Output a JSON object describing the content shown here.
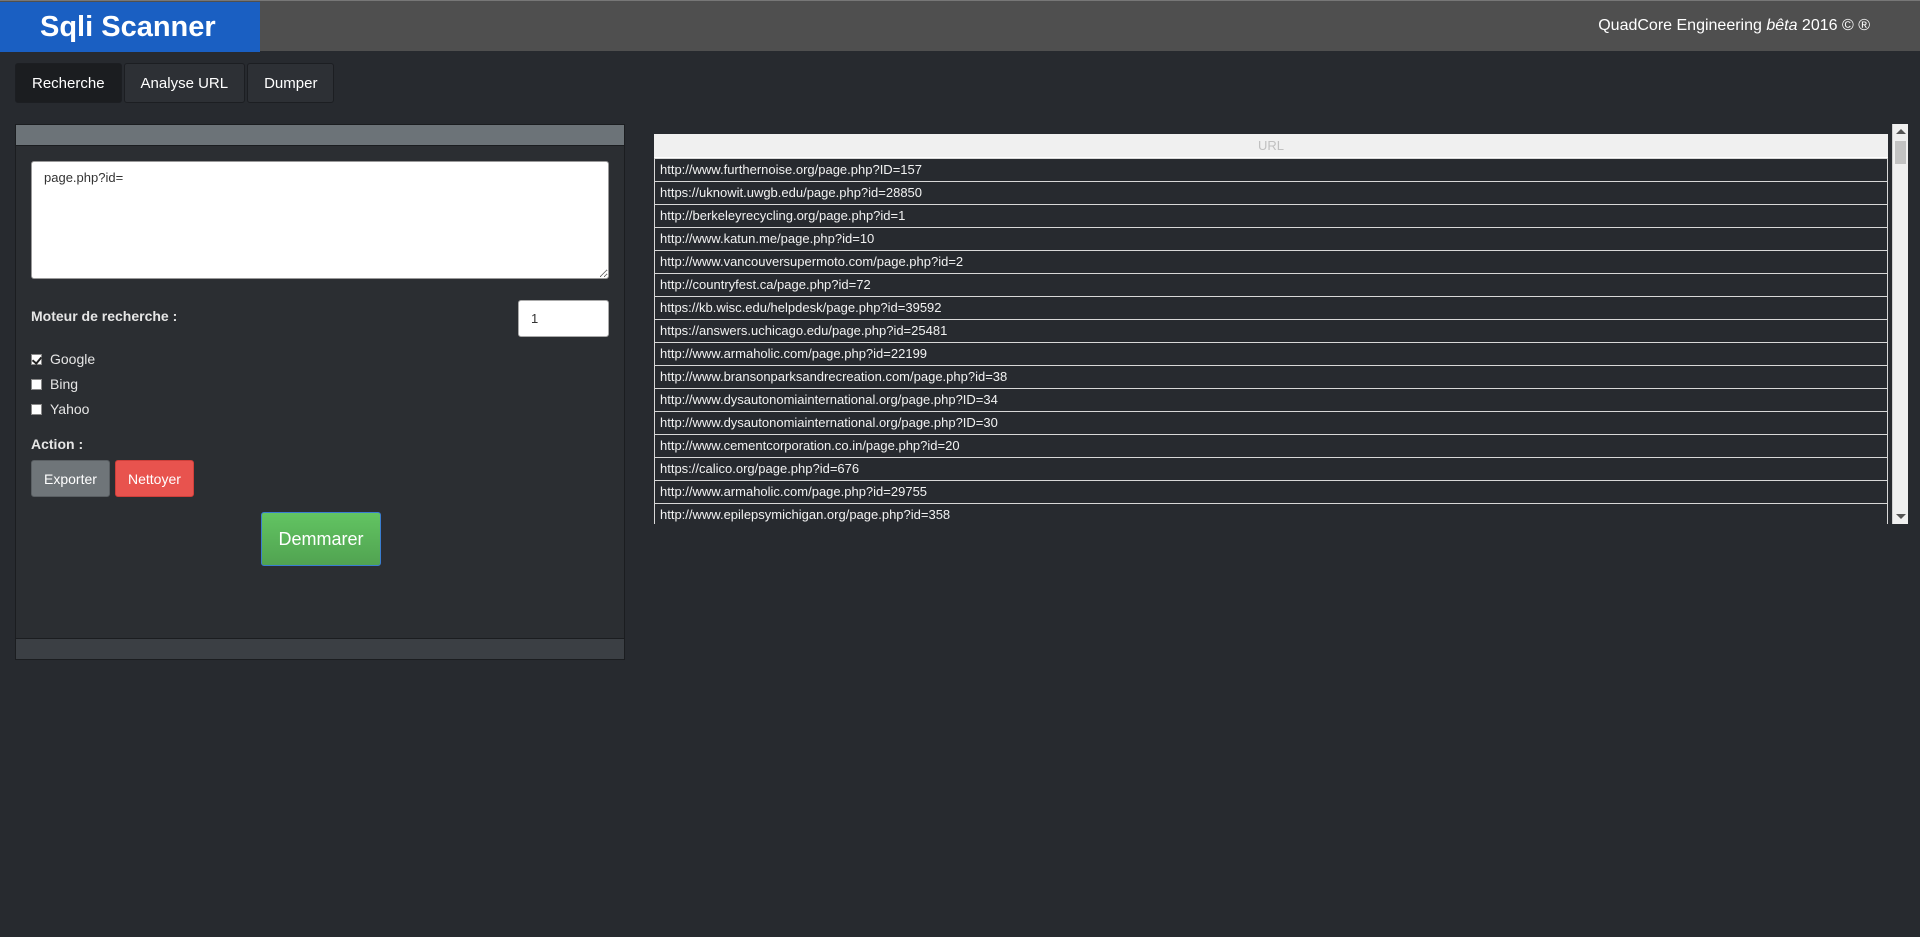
{
  "header": {
    "app_title": "Sqli Scanner",
    "credits_prefix": "QuadCore Engineering ",
    "credits_beta": "bêta",
    "credits_suffix": " 2016 © ®"
  },
  "tabs": [
    {
      "label": "Recherche",
      "active": true
    },
    {
      "label": "Analyse URL",
      "active": false
    },
    {
      "label": "Dumper",
      "active": false
    }
  ],
  "search": {
    "query_value": "page.php?id=",
    "pages_value": "1",
    "engines_label": "Moteur de recherche :",
    "engines": [
      {
        "label": "Google",
        "checked": true
      },
      {
        "label": "Bing",
        "checked": false
      },
      {
        "label": "Yahoo",
        "checked": false
      }
    ],
    "action_label": "Action :",
    "export_label": "Exporter",
    "clean_label": "Nettoyer",
    "start_label": "Demmarer"
  },
  "results": {
    "column_header": "URL",
    "rows": [
      "http://www.furthernoise.org/page.php?ID=157",
      "https://uknowit.uwgb.edu/page.php?id=28850",
      "http://berkeleyrecycling.org/page.php?id=1",
      "http://www.katun.me/page.php?id=10",
      "http://www.vancouversupermoto.com/page.php?id=2",
      "http://countryfest.ca/page.php?id=72",
      "https://kb.wisc.edu/helpdesk/page.php?id=39592",
      "https://answers.uchicago.edu/page.php?id=25481",
      "http://www.armaholic.com/page.php?id=22199",
      "http://www.bransonparksandrecreation.com/page.php?id=38",
      "http://www.dysautonomiainternational.org/page.php?ID=34",
      "http://www.dysautonomiainternational.org/page.php?ID=30",
      "http://www.cementcorporation.co.in/page.php?id=20",
      "https://calico.org/page.php?id=676",
      "http://www.armaholic.com/page.php?id=29755",
      "http://www.epilepsymichigan.org/page.php?id=358"
    ]
  },
  "colors": {
    "brand": "#1a5fc2",
    "background": "#272a2f",
    "danger": "#e8534e",
    "success": "#5cb85c"
  }
}
